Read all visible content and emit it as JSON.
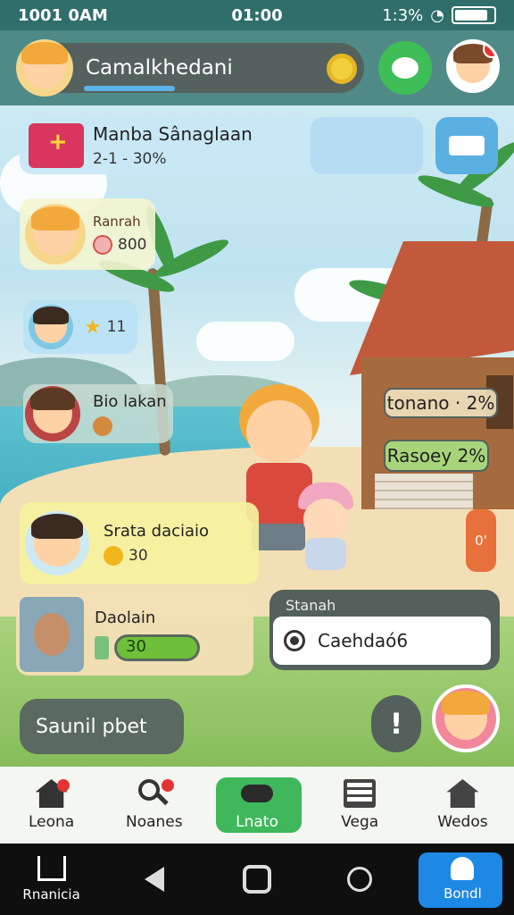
{
  "status_bar": {
    "time": "1001 0AM",
    "center_time": "01:00",
    "right_text": "1:3%"
  },
  "header": {
    "player_name": "Camalkhedani",
    "xp_fraction": 0.4
  },
  "quest_card": {
    "title": "Manba Sânaglaan",
    "subtitle": "2-1 - 30%"
  },
  "players": [
    {
      "name": "Ranrah",
      "value": "800"
    },
    {
      "name": "",
      "value": "11"
    },
    {
      "name": "Bio lakan",
      "value": ""
    },
    {
      "name": "Srata daciaio",
      "value": "30"
    },
    {
      "name": "Daolain",
      "value": "30"
    }
  ],
  "progress_labels": [
    {
      "label": "tonano",
      "percent": "2%"
    },
    {
      "label": "Rasoey",
      "percent": "2%"
    }
  ],
  "side_badge": "0'",
  "task": {
    "label": "Stanah",
    "value": "Caehdaó6"
  },
  "chat_placeholder": "Saunil pbet",
  "alert_label": "!",
  "game_nav": [
    {
      "label": "Leona",
      "icon": "home-icon",
      "badge": true
    },
    {
      "label": "Noanes",
      "icon": "search-icon",
      "badge": true
    },
    {
      "label": "Lnato",
      "icon": "gamepad-icon",
      "badge": false,
      "active": true
    },
    {
      "label": "Vega",
      "icon": "list-icon",
      "badge": false
    },
    {
      "label": "Wedos",
      "icon": "village-icon",
      "badge": false
    }
  ],
  "sys_nav": [
    {
      "label": "Rnanicia",
      "icon": "home-outline-icon"
    },
    {
      "label": "",
      "icon": "back-icon"
    },
    {
      "label": "",
      "icon": "recent-apps-icon"
    },
    {
      "label": "",
      "icon": "search-icon"
    },
    {
      "label": "Bondl",
      "icon": "bell-icon",
      "active": true
    }
  ],
  "colors": {
    "accent_green": "#3fb85b",
    "header_teal": "#4f8a86",
    "active_blue": "#1e88e5",
    "badge_red": "#e33434"
  }
}
